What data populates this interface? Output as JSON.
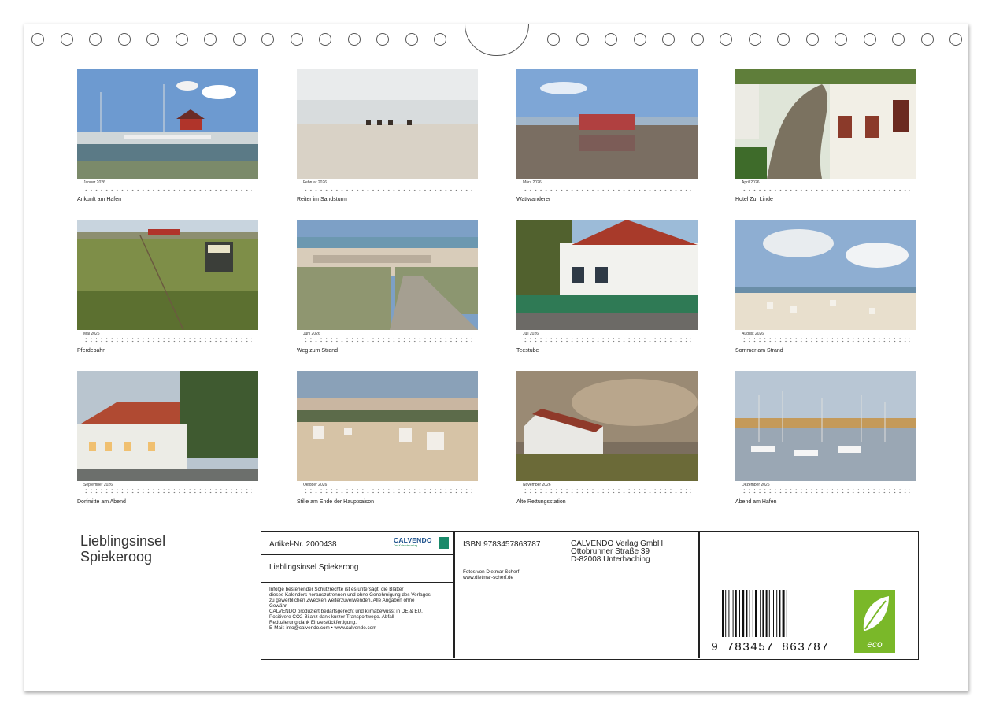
{
  "year": "2026",
  "months": [
    {
      "name": "Januar 2026",
      "caption": "Ankunft am Hafen",
      "scene": "harbor"
    },
    {
      "name": "Februar 2026",
      "caption": "Reiter im Sandsturm",
      "scene": "riders"
    },
    {
      "name": "März 2026",
      "caption": "Wattwanderer",
      "scene": "mudflat"
    },
    {
      "name": "April 2026",
      "caption": "Hotel Zur Linde",
      "scene": "tree"
    },
    {
      "name": "Mai 2026",
      "caption": "Pferdebahn",
      "scene": "meadow"
    },
    {
      "name": "Juni 2026",
      "caption": "Weg zum Strand",
      "scene": "path"
    },
    {
      "name": "Juli 2026",
      "caption": "Teestube",
      "scene": "teahouse"
    },
    {
      "name": "August 2026",
      "caption": "Sommer am Strand",
      "scene": "beach"
    },
    {
      "name": "September 2026",
      "caption": "Dorfmitte am Abend",
      "scene": "village"
    },
    {
      "name": "Oktober 2026",
      "caption": "Stille am Ende der Hauptsaison",
      "scene": "dusk"
    },
    {
      "name": "November 2026",
      "caption": "Alte Rettungsstation",
      "scene": "station"
    },
    {
      "name": "Dezember 2026",
      "caption": "Abend am Hafen",
      "scene": "marina"
    }
  ],
  "cover_title_line1": "Lieblingsinsel",
  "cover_title_line2": "Spiekeroog",
  "info": {
    "article_no": "Artikel-Nr. 2000438",
    "publisher_logo": "CALVENDO",
    "publisher_logo_sub": "Der Kalenderverlag",
    "product_title": "Lieblingsinsel Spiekeroog",
    "legal": [
      "Infolge bestehender Schutzrechte ist es untersagt, die Blätter",
      "dieses Kalenders herauszutrennen und ohne Genehmigung des Verlages",
      "zu gewerblichen Zwecken weiterzuverwenden. Alle Angaben ohne",
      "Gewähr.",
      "CALVENDO produziert bedarfsgerecht und klimabewusst in DE & EU.",
      "Positivere CO2-Bilanz dank kurzer Transportwege. Abfall-",
      "Reduzierung dank Einzelstückfertigung.",
      "E-Mail: info@calvendo.com • www.calvendo.com"
    ],
    "isbn": "ISBN 9783457863787",
    "photo_credit": "Fotos von Dietmar Scherf",
    "photo_web": "www.dietmar-scherf.de",
    "publisher_name": "CALVENDO Verlag GmbH",
    "publisher_street": "Ottobrunner Straße 39",
    "publisher_city": "D-82008 Unterhaching",
    "barcode_number": "9 783457 863787",
    "eco_label": "eco"
  },
  "colors": {
    "sky": "#8fb3d9",
    "sand": "#d9cdb6",
    "eco_green": "#7ab829",
    "calvendo_blue": "#1a4f8b"
  }
}
